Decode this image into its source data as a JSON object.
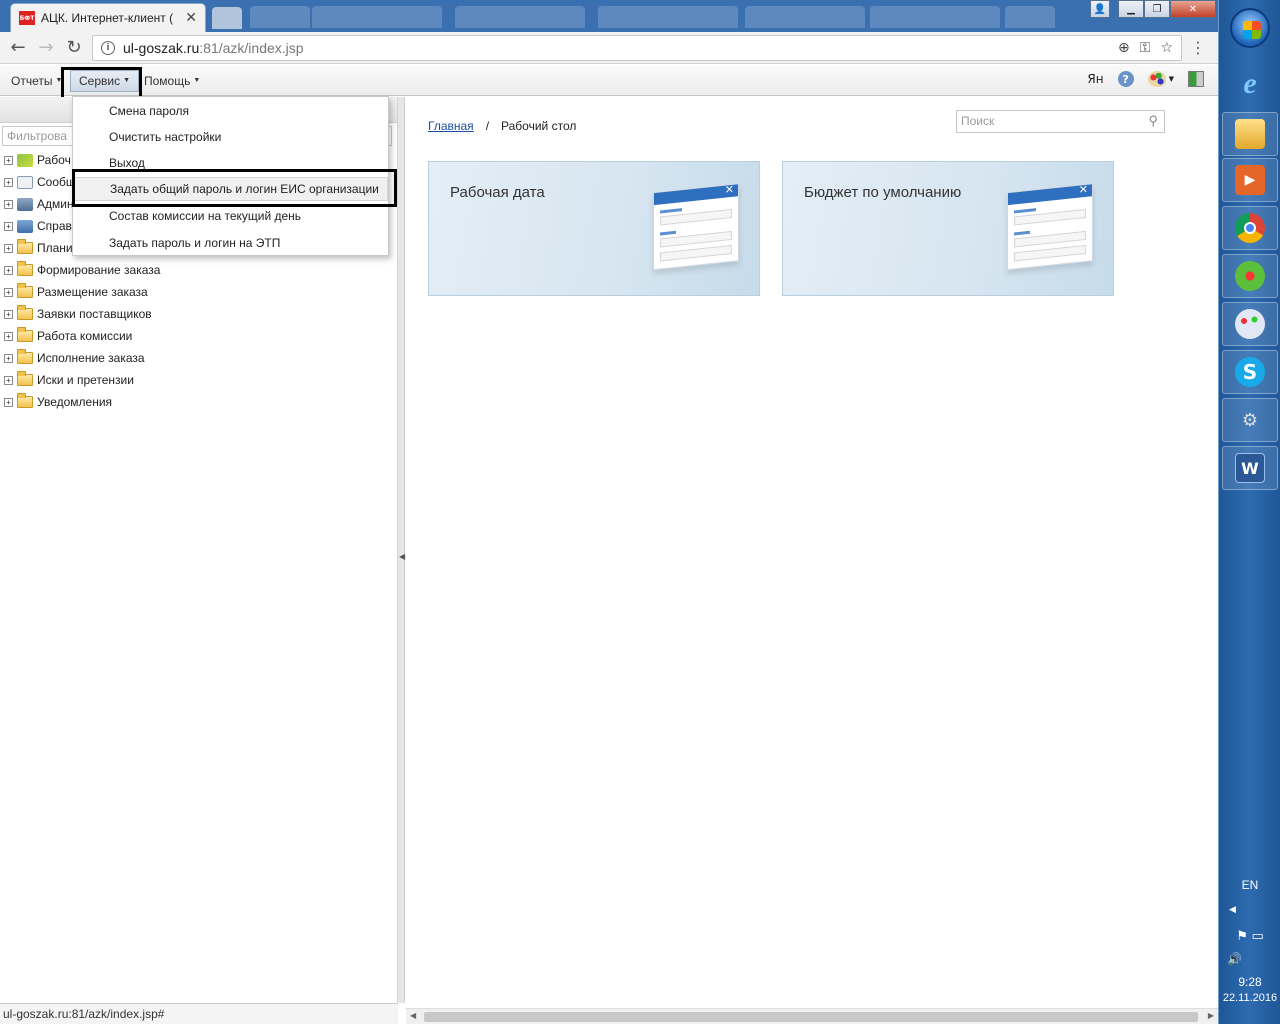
{
  "browser": {
    "tab_title": "АЦК. Интернет-клиент (",
    "tab_favicon_text": "БФТ",
    "url_host": "ul-goszak.ru",
    "url_path": ":81/azk/index.jsp",
    "window_buttons": {
      "minimize": "▁",
      "restore": "❐",
      "close": "✕"
    },
    "icons": {
      "back": "back-arrow-icon",
      "forward": "forward-arrow-icon",
      "reload": "reload-icon",
      "info": "info-icon",
      "zoom": "zoom-icon",
      "key": "key-icon",
      "star": "bookmark-star-icon",
      "menu": "menu-dots-icon"
    }
  },
  "menubar": {
    "reports": "Отчеты",
    "service": "Сервис",
    "help": "Помощь",
    "user": "Ян"
  },
  "service_menu": {
    "items": [
      "Смена пароля",
      "Очистить настройки",
      "Выход",
      "Задать общий пароль и логин ЕИС организации",
      "Состав комиссии на текущий день",
      "Задать пароль и логин на ЭТП"
    ],
    "active_index": 3
  },
  "left_panel": {
    "filter_placeholder": "Фильтрова",
    "tree": [
      {
        "label": "Рабоч",
        "icon": "broom-icon"
      },
      {
        "label": "Сообщ",
        "icon": "envelope-icon"
      },
      {
        "label": "Админ",
        "icon": "computer-icon"
      },
      {
        "label": "Справ",
        "icon": "book-icon"
      },
      {
        "label": "Плани",
        "icon": "folder-icon"
      },
      {
        "label": "Формирование заказа",
        "icon": "folder-icon"
      },
      {
        "label": "Размещение заказа",
        "icon": "folder-icon"
      },
      {
        "label": "Заявки поставщиков",
        "icon": "folder-icon"
      },
      {
        "label": "Работа комиссии",
        "icon": "folder-icon"
      },
      {
        "label": "Исполнение заказа",
        "icon": "folder-icon"
      },
      {
        "label": "Иски и претензии",
        "icon": "folder-icon"
      },
      {
        "label": "Уведомления",
        "icon": "folder-icon"
      }
    ]
  },
  "main": {
    "breadcrumb_home": "Главная",
    "breadcrumb_sep": "/",
    "breadcrumb_current": "Рабочий стол",
    "search_placeholder": "Поиск",
    "cards": [
      "Рабочая дата",
      "Бюджет по умолчанию"
    ]
  },
  "status_text": "ul-goszak.ru:81/azk/index.jsp#",
  "taskbar": {
    "apps": [
      "internet-explorer-icon",
      "file-explorer-icon",
      "media-player-icon",
      "chrome-icon",
      "icq-icon",
      "paint-icon",
      "skype-icon",
      "network-tool-icon",
      "word-icon"
    ],
    "lang": "EN",
    "time": "9:28",
    "date": "22.11.2016"
  }
}
